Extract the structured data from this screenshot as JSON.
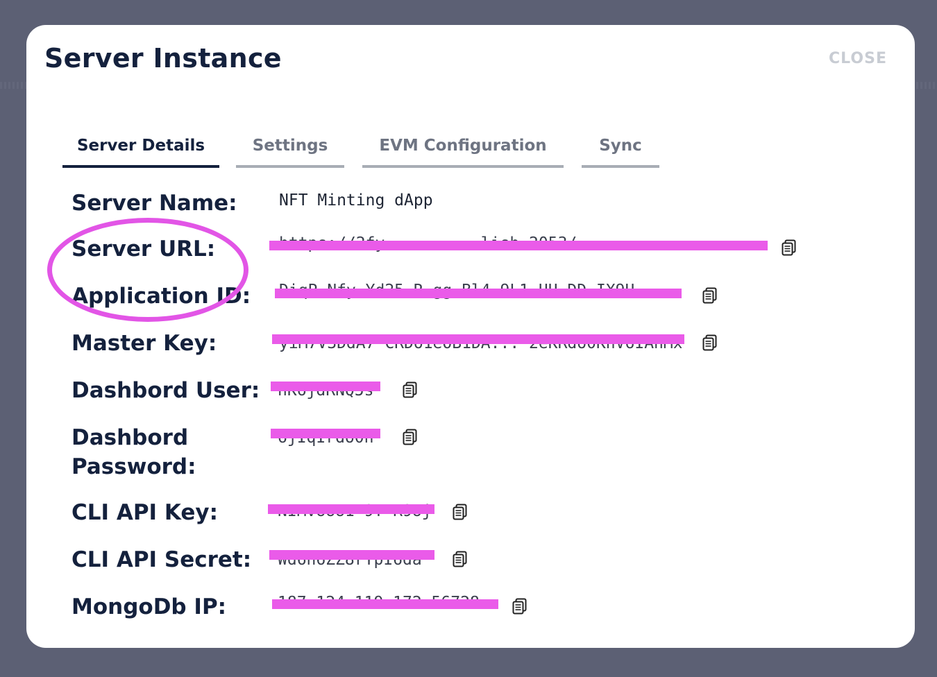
{
  "modal": {
    "title": "Server Instance",
    "close_label": "CLOSE"
  },
  "tabs": [
    {
      "label": "Server Details",
      "active": true
    },
    {
      "label": "Settings",
      "active": false
    },
    {
      "label": "EVM Configuration",
      "active": false
    },
    {
      "label": "Sync",
      "active": false
    }
  ],
  "details": {
    "server_name": {
      "label": "Server Name:",
      "value": "NFT Minting dApp"
    },
    "server_url": {
      "label": "Server URL:",
      "value": "https://2fy    .....    ...lish      2053/"
    },
    "application_id": {
      "label": "Application ID:",
      "value": "DiqP   Nfy  Yd25 R  gg Bl4  9L1 UU DD IX9U"
    },
    "master_key": {
      "label": "Master Key:",
      "value": "yiM7V3DdA7 CRDo1eOB1DA... 2eKRdo0KhV6IAhMx"
    },
    "dashboard_user": {
      "label": "Dashbord User:",
      "value": "nK6jdRNQ5s"
    },
    "dashboard_password": {
      "label": "Dashbord Password:",
      "value": "6jIqIrdo0h"
    },
    "cli_api_key": {
      "label": "CLI API Key:",
      "value": "NIMVUUU1 9T R9Uj"
    },
    "cli_api_secret": {
      "label": "CLI API Secret:",
      "value": "Wd6h6ZZ8rYpI6da"
    },
    "mongodb_ip": {
      "label": "MongoDb IP:",
      "value": "187.124.119.172:56728"
    }
  },
  "colors": {
    "title": "#14213d",
    "redaction": "#ea5be9",
    "annotation": "#e255e6",
    "backdrop": "#5c6074"
  },
  "icons": {
    "copy": "clipboard-copy-icon"
  }
}
